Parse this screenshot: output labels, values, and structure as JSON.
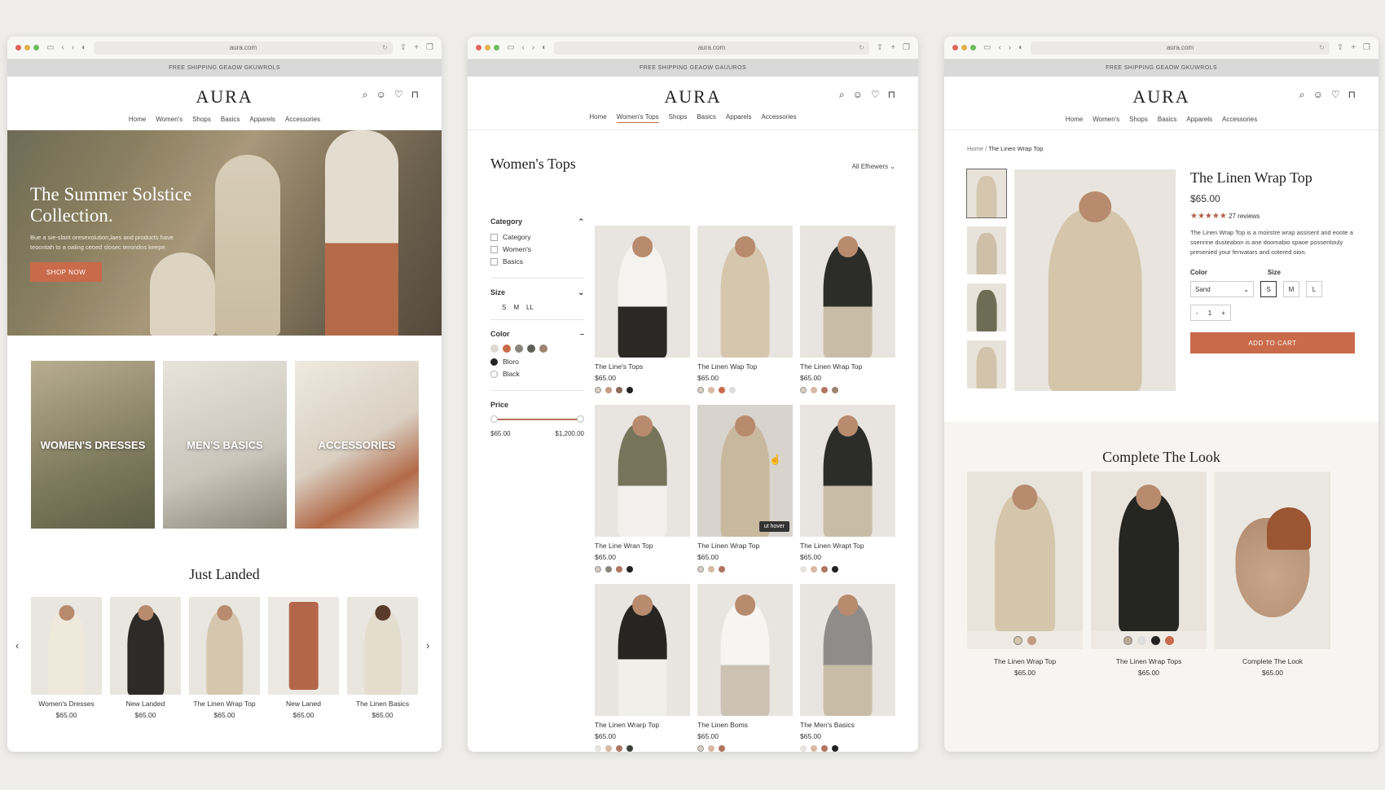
{
  "browser": {
    "url": "aura.com"
  },
  "promo": "FREE SHIPPING GEAOW GKUWROLS",
  "promo2": "FREE SHIPPING GEAOW GAUUROS",
  "promo3": "FREE SHIPPING GEAOW GKUWROLS",
  "brand": "AURA",
  "nav": [
    "Home",
    "Women's",
    "Shops",
    "Basics",
    "Apparels",
    "Accessories"
  ],
  "nav2": [
    "Home",
    "Women's Tops",
    "Shops",
    "Basics",
    "Apparels",
    "Accessories"
  ],
  "home": {
    "hero_title": "The Summer Solstice Collection.",
    "hero_body": "Bue a sie-slant oresexolution,laes and products have teoontah to a oaling ceoed slosec terondos keepe.",
    "cta": "SHOP NOW",
    "categories": [
      "WOMEN'S DRESSES",
      "MEN'S BASICS",
      "ACCESSORIES"
    ],
    "just_landed": "Just Landed",
    "products": [
      {
        "name": "Women's Dresses",
        "price": "$65.00"
      },
      {
        "name": "New Landed",
        "price": "$65.00"
      },
      {
        "name": "The Linen Wrap Top",
        "price": "$65.00"
      },
      {
        "name": "New Laned",
        "price": "$65.00"
      },
      {
        "name": "The Linen Basics",
        "price": "$65.00"
      }
    ]
  },
  "plp": {
    "title": "Women's Tops",
    "sort": "All Efhewers",
    "filters": {
      "category_label": "Category",
      "categories": [
        "Category",
        "Women's",
        "Basics"
      ],
      "size_label": "Size",
      "sizes": [
        "S",
        "M",
        "LL"
      ],
      "color_label": "Color",
      "colors": [
        "Bloro",
        "Black"
      ],
      "price_label": "Price",
      "price_min": "$65.00",
      "price_max": "$1,200.00"
    },
    "products": [
      {
        "name": "The Line's Tops",
        "price": "$65.00"
      },
      {
        "name": "The Linen Wap Top",
        "price": "$65.00"
      },
      {
        "name": "The Linen Wrap Top",
        "price": "$65.00"
      },
      {
        "name": "The Line Wran Top",
        "price": "$65.00"
      },
      {
        "name": "The Linen Wrap Top",
        "price": "$65.00"
      },
      {
        "name": "The Linen Wrapt Top",
        "price": "$65.00"
      },
      {
        "name": "The Linen Wrarp Top",
        "price": "$65.00"
      },
      {
        "name": "The Linen Boms",
        "price": "$65.00"
      },
      {
        "name": "The Men's Basics",
        "price": "$65.00"
      }
    ],
    "hover_tag": "ut hover"
  },
  "pdp": {
    "crumb_home": "Home",
    "crumb_sep": "/",
    "crumb_current": "The Linen Wrap Top",
    "title": "The Linen Wrap Top",
    "price": "$65.00",
    "stars": "★★★★★",
    "reviews": "27 reviews",
    "desc": "The Linen Wrap Top is a moirstre wrap assisent and eoote a ssenrine dusteabon is ane doomabio spaoe posseritouly presenied your fenvatars and cotered oion.",
    "color_label": "Color",
    "color_value": "Sand",
    "size_label": "Size",
    "sizes": [
      "S",
      "M",
      "L"
    ],
    "qty": "1",
    "minus": "-",
    "plus": "+",
    "add": "ADD TO CART",
    "complete": "Complete The Look",
    "looks": [
      {
        "name": "The Linen Wrap Top",
        "price": "$65.00"
      },
      {
        "name": "The Linen Wrap Tops",
        "price": "$65.00"
      },
      {
        "name": "Complete The Look",
        "price": "$65.00"
      }
    ]
  },
  "colors": {
    "accent": "#c96a4a",
    "text": "#2b2a28",
    "bg": "#eeedea"
  }
}
